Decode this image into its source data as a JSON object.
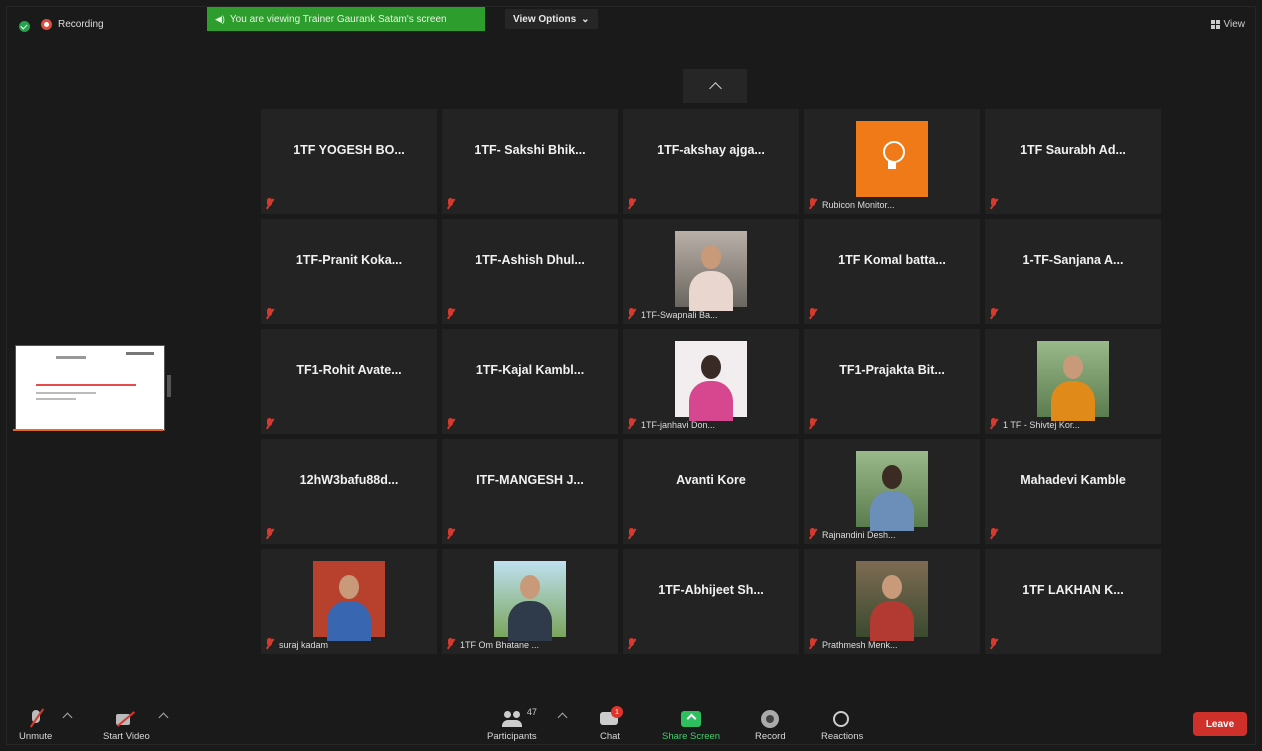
{
  "topbar": {
    "recording_label": "Recording",
    "viewing_text": "You are viewing Trainer Gaurank Satam's screen",
    "view_options_label": "View Options",
    "view_button_label": "View"
  },
  "participants": [
    {
      "name": "1TF YOGESH BO...",
      "label": ""
    },
    {
      "name": "1TF- Sakshi Bhik...",
      "label": ""
    },
    {
      "name": "1TF-akshay ajga...",
      "label": ""
    },
    {
      "name": "",
      "label": "Rubicon Monitor..."
    },
    {
      "name": "1TF Saurabh Ad...",
      "label": ""
    },
    {
      "name": "1TF-Pranit Koka...",
      "label": ""
    },
    {
      "name": "1TF-Ashish Dhul...",
      "label": ""
    },
    {
      "name": "",
      "label": "1TF-Swapnali Ba..."
    },
    {
      "name": "1TF Komal batta...",
      "label": ""
    },
    {
      "name": "1-TF-Sanjana A...",
      "label": ""
    },
    {
      "name": "TF1-Rohit Avate...",
      "label": ""
    },
    {
      "name": "1TF-Kajal Kambl...",
      "label": ""
    },
    {
      "name": "",
      "label": "1TF-janhavi Don..."
    },
    {
      "name": "TF1-Prajakta Bit...",
      "label": ""
    },
    {
      "name": "",
      "label": "1 TF - Shivtej Kor..."
    },
    {
      "name": "12hW3bafu88d...",
      "label": ""
    },
    {
      "name": "ITF-MANGESH J...",
      "label": ""
    },
    {
      "name": "Avanti Kore",
      "label": ""
    },
    {
      "name": "",
      "label": "Rajnandini Desh..."
    },
    {
      "name": "Mahadevi Kamble",
      "label": ""
    },
    {
      "name": "",
      "label": "suraj kadam"
    },
    {
      "name": "",
      "label": "1TF Om Bhatane ..."
    },
    {
      "name": "1TF-Abhijeet Sh...",
      "label": ""
    },
    {
      "name": "",
      "label": "Prathmesh Menk..."
    },
    {
      "name": "1TF LAKHAN K...",
      "label": ""
    }
  ],
  "toolbar": {
    "unmute_label": "Unmute",
    "start_video_label": "Start Video",
    "participants_label": "Participants",
    "participants_count": "47",
    "chat_label": "Chat",
    "chat_badge": "1",
    "share_screen_label": "Share Screen",
    "record_label": "Record",
    "reactions_label": "Reactions",
    "leave_label": "Leave"
  },
  "colors": {
    "background": "#1a1a1a",
    "tile": "#232323",
    "viewing_banner": "#2d9e2d",
    "leave": "#cf3029",
    "share": "#2ec05e",
    "muted": "#d63a2f"
  }
}
